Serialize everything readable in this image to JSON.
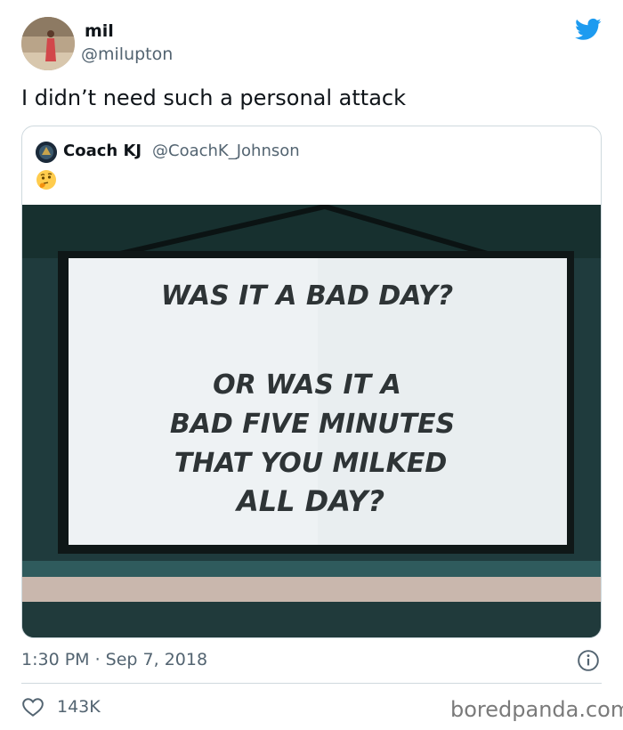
{
  "author": {
    "name": "mil",
    "handle": "@milupton"
  },
  "tweet": {
    "text": "I didn’t need such a personal attack"
  },
  "quoted": {
    "name": "Coach KJ",
    "handle": "@CoachK_Johnson",
    "emoji": "🤔",
    "sign_lines": [
      "WAS IT A BAD DAY?",
      "OR WAS IT A",
      "BAD FIVE MINUTES",
      "THAT YOU MILKED",
      "ALL DAY?"
    ]
  },
  "meta": {
    "timestamp": "1:30 PM · Sep 7, 2018",
    "likes": "143K"
  },
  "watermark": "boredpanda.com",
  "colors": {
    "twitter_blue": "#1d9bf0",
    "secondary_text": "#536471"
  },
  "icons": {
    "logo": "twitter-bird-icon",
    "info": "info-icon",
    "like": "heart-icon"
  }
}
